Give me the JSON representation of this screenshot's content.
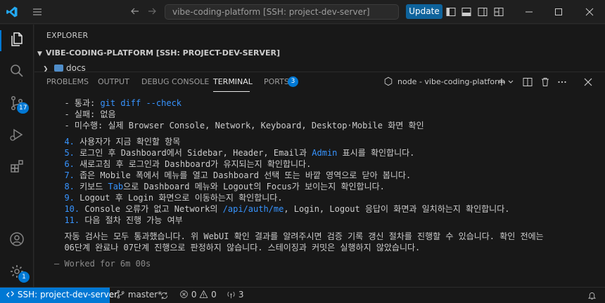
{
  "titlebar": {
    "search_text": "vibe-coding-platform [SSH: project-dev-server]",
    "update_label": "Update"
  },
  "activity": {
    "source_control_badge": "17",
    "settings_badge": "1"
  },
  "explorer": {
    "title": "EXPLORER",
    "folder": "VIBE-CODING-PLATFORM [SSH: PROJECT-DEV-SERVER]",
    "item": "docs"
  },
  "panel": {
    "tabs": [
      "PROBLEMS",
      "OUTPUT",
      "DEBUG CONSOLE",
      "TERMINAL",
      "PORTS"
    ],
    "active_tab": "TERMINAL",
    "ports_badge": "3",
    "terminal_name": "node - vibe-coding-platform"
  },
  "terminal": {
    "l1_prefix": "  - 통과: ",
    "l1_code": "git diff --check",
    "l2": "  - 실패: 없음",
    "l3": "  - 미수행: 실제 Browser Console, Network, Keyboard, Desktop·Mobile 화면 확인",
    "n4": "  4.",
    "t4": " 사용자가 지금 확인할 항목",
    "n5": "  5.",
    "t5a": " 로그인 후 Dashboard에서 Sidebar, Header, Email과 ",
    "t5code": "Admin",
    "t5b": " 표시를 확인합니다.",
    "n6": "  6.",
    "t6": " 새로고침 후 로그인과 Dashboard가 유지되는지 확인합니다.",
    "n7": "  7.",
    "t7": " 좁은 Mobile 폭에서 메뉴를 열고 Dashboard 선택 또는 바깥 영역으로 닫아 봅니다.",
    "n8": "  8.",
    "t8a": " 키보드 ",
    "t8code": "Tab",
    "t8b": "으로 Dashboard 메뉴와 Logout의 Focus가 보이는지 확인합니다.",
    "n9": "  9.",
    "t9": " Logout 후 Login 화면으로 이동하는지 확인합니다.",
    "n10": "  10.",
    "t10a": " Console 오류가 없고 Network의 ",
    "t10code": "/api/auth/me",
    "t10b": ", Login, Logout 응답이 화면과 일치하는지 확인합니다.",
    "n11": "  11.",
    "t11": " 다음 절차 진행 가능 여부",
    "p1": "  자동 검사는 모두 통과했습니다. 위 WebUI 확인 결과를 알려주시면 검증 기록 갱신 절차를 진행할 수 있습니다. 확인 전에는",
    "p2": "  06단계 완료나 07단계 진행으로 판정하지 않습니다. 스테이징과 커밋은 실행하지 않았습니다.",
    "worked": "— Worked for 6m 00s"
  },
  "statusbar": {
    "remote": "SSH: project-dev-server",
    "branch": "master*",
    "errors": "0",
    "warnings": "0",
    "ports": "3"
  }
}
